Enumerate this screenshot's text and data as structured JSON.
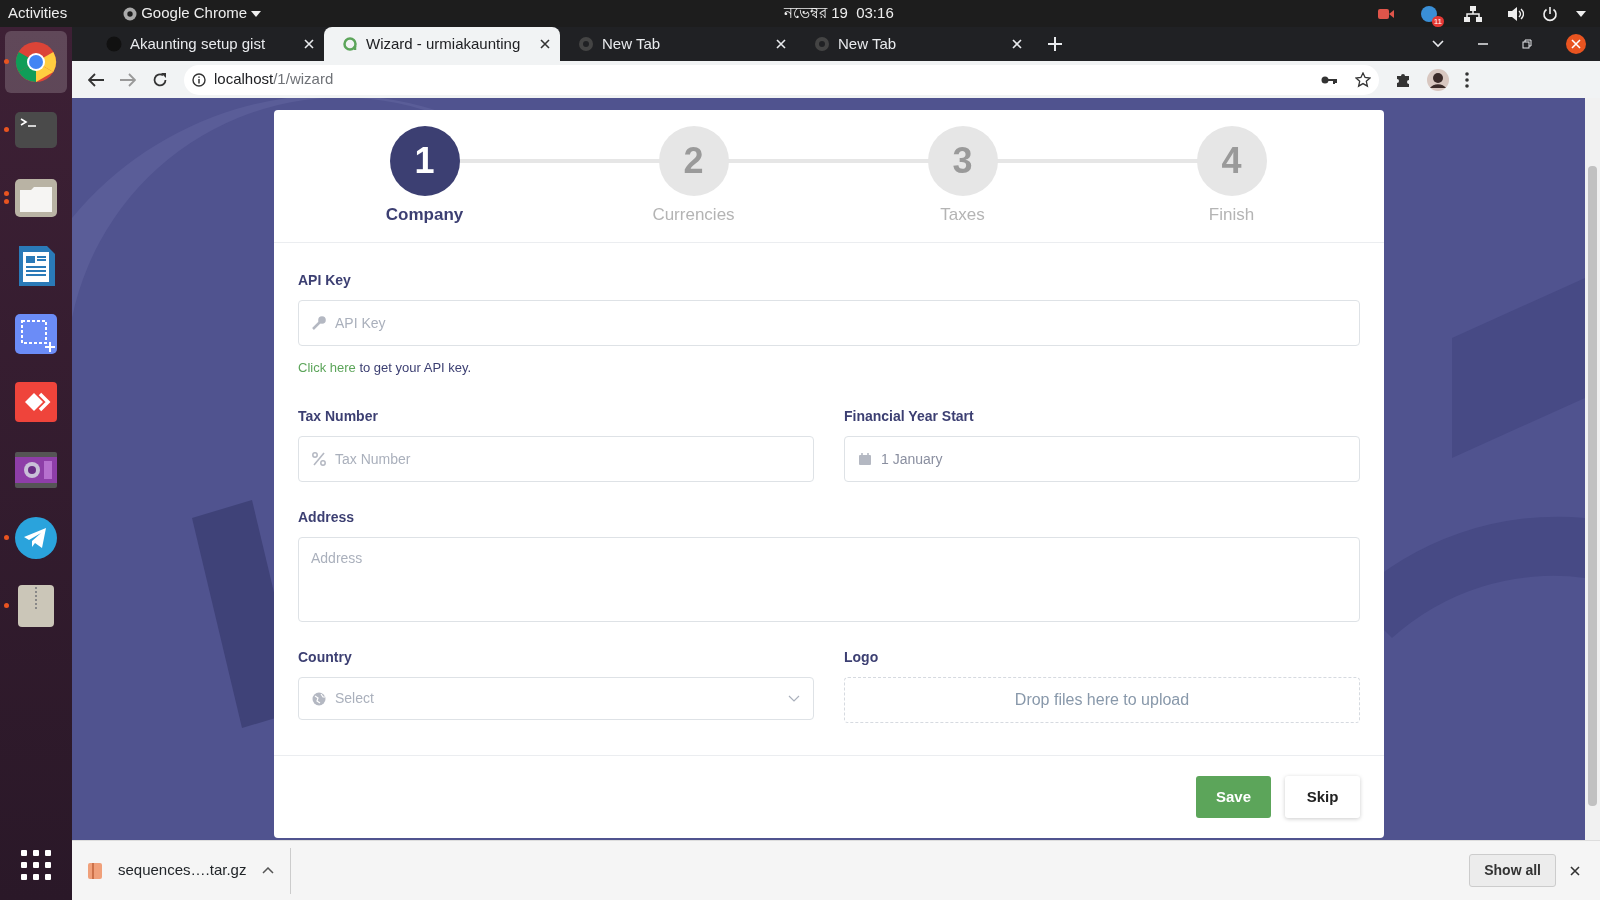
{
  "top_bar": {
    "activities": "Activities",
    "app_menu": "Google Chrome",
    "clock": "নভেম্বর 19  03:16",
    "notification_count": "11"
  },
  "dock": {
    "items": [
      {
        "kind": "browser",
        "running": true,
        "multi_window": false,
        "selected": true
      },
      {
        "kind": "terminal",
        "running": true,
        "multi_window": false,
        "selected": false
      },
      {
        "kind": "files",
        "running": true,
        "multi_window": true,
        "selected": false
      },
      {
        "kind": "writer",
        "running": false,
        "multi_window": false,
        "selected": false
      },
      {
        "kind": "screenshot",
        "running": false,
        "multi_window": false,
        "selected": false
      },
      {
        "kind": "remote",
        "running": false,
        "multi_window": false,
        "selected": false
      },
      {
        "kind": "video",
        "running": false,
        "multi_window": false,
        "selected": false
      },
      {
        "kind": "telegram",
        "running": true,
        "multi_window": false,
        "selected": false
      },
      {
        "kind": "archive",
        "running": true,
        "multi_window": false,
        "selected": false
      }
    ]
  },
  "tabs": [
    {
      "title": "Akaunting setup gist",
      "kind": "github",
      "selected": false
    },
    {
      "title": "Wizard - urmiakaunting",
      "kind": "app",
      "selected": true
    },
    {
      "title": "New Tab",
      "kind": "newtab",
      "selected": false
    },
    {
      "title": "New Tab",
      "kind": "newtab",
      "selected": false
    }
  ],
  "address_bar": {
    "host": "localhost",
    "path": "/1/wizard"
  },
  "steps": [
    {
      "number": "1",
      "label": "Company",
      "selected": true
    },
    {
      "number": "2",
      "label": "Currencies",
      "selected": false
    },
    {
      "number": "3",
      "label": "Taxes",
      "selected": false
    },
    {
      "number": "4",
      "label": "Finish",
      "selected": false
    }
  ],
  "form": {
    "api_key": {
      "label": "API Key",
      "placeholder": "API Key"
    },
    "api_help": {
      "link": "Click here",
      "text": "to get your API key."
    },
    "tax_number": {
      "label": "Tax Number",
      "placeholder": "Tax Number"
    },
    "financial_year_start": {
      "label": "Financial Year Start",
      "value": "1 January"
    },
    "address": {
      "label": "Address",
      "placeholder": "Address"
    },
    "country": {
      "label": "Country",
      "placeholder": "Select"
    },
    "logo": {
      "label": "Logo",
      "dropzone": "Drop files here to upload"
    },
    "buttons": [
      {
        "label": "Save",
        "kind": "primary"
      },
      {
        "label": "Skip",
        "kind": "secondary"
      }
    ]
  },
  "download_bar": {
    "file": "sequences….tar.gz",
    "show_all": "Show all"
  }
}
